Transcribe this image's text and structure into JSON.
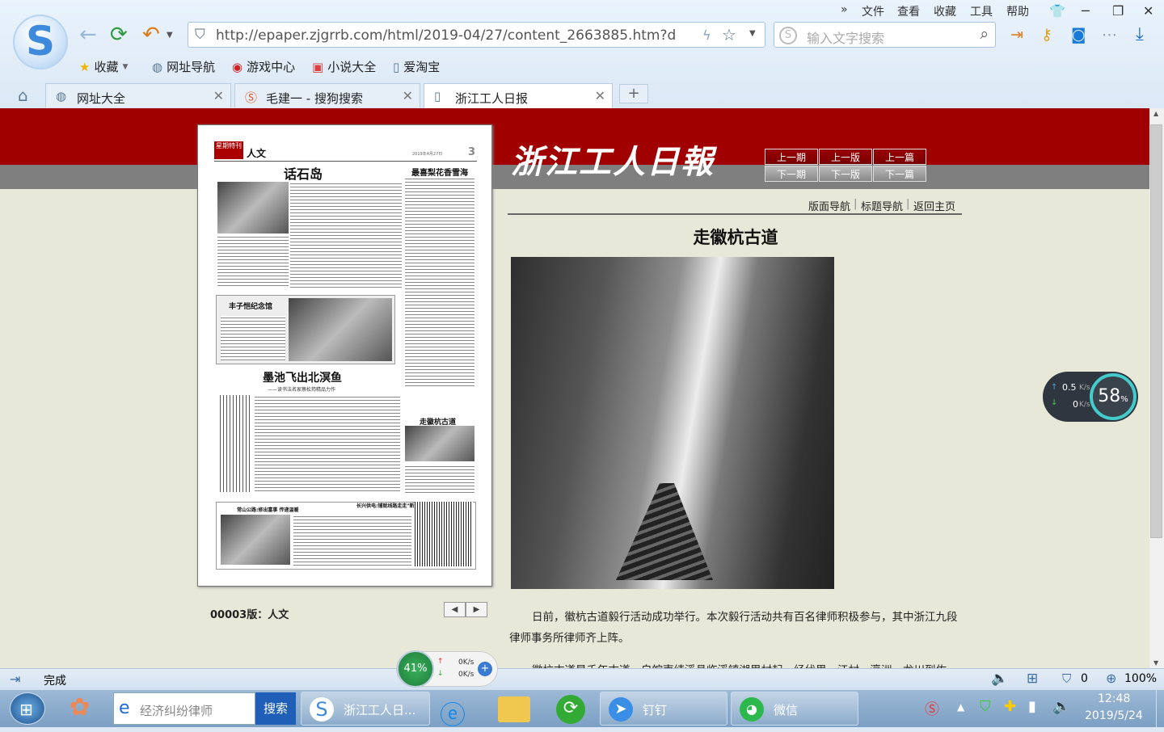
{
  "menu": {
    "file": "文件",
    "view": "查看",
    "favorites": "收藏",
    "tools": "工具",
    "help": "帮助",
    "more": "»"
  },
  "address": {
    "url": "http://epaper.zjgrrb.com/html/2019-04/27/content_2663885.htm?d"
  },
  "search": {
    "placeholder": "输入文字搜索"
  },
  "bookmarks": [
    "收藏",
    "网址导航",
    "游戏中心",
    "小说大全",
    "爱淘宝"
  ],
  "tabs": [
    {
      "label": "网址大全"
    },
    {
      "label": "毛建一 - 搜狗搜索"
    },
    {
      "label": "浙江工人日报"
    }
  ],
  "masthead": "浙江工人日報",
  "page_nav": {
    "prev_issue": "上一期",
    "prev_page": "上一版",
    "prev_article": "上一篇",
    "next_issue": "下一期",
    "next_page": "下一版",
    "next_article": "下一篇"
  },
  "paper": {
    "section_tag": "星期特刊",
    "section": "人文",
    "page_no": "3",
    "date_line": "2019年4月27日",
    "headline1": "话石岛",
    "headline2": "最喜梨花香雪海",
    "headline3": "丰子恺纪念馆",
    "headline4": "墨池飞出北溟鱼",
    "subhead4": "——读书法名家蔡松筠精品力作",
    "headline5": "走徽杭古道",
    "headline6": "常山公路:修出富事 传递温暖",
    "headline7": "长兴供电:铺就线路走走\"新点\""
  },
  "edition": "00003版：人文",
  "article_nav": {
    "page_nav": "版面导航",
    "title_nav": "标题导航",
    "home": "返回主页"
  },
  "article": {
    "title": "走徽杭古道",
    "para1": "日前，徽杭古道毅行活动成功举行。本次毅行活动共有百名律师积极参与，其中浙江九段律师事务所律师齐上阵。",
    "para2": "徽杭古道是千年古道，自皖南绩溪县临溪镇湖里村起，经伏里、江村、瀛洲、龙川到佐"
  },
  "status": {
    "text": "完成",
    "count": "0",
    "zoom": "100%"
  },
  "speed_widget": {
    "up": "0.5",
    "down": "0",
    "unit": "K/s",
    "percent": "58",
    "pct_sign": "%"
  },
  "speed_widget2": {
    "percent": "41%",
    "up": "0K/s",
    "down": "0K/s"
  },
  "taskbar": {
    "search_placeholder": "经济纠纷律师",
    "search_btn": "搜索",
    "items": [
      "浙江工人日...",
      "钉钉",
      "微信"
    ],
    "time": "12:48",
    "date": "2019/5/24"
  }
}
